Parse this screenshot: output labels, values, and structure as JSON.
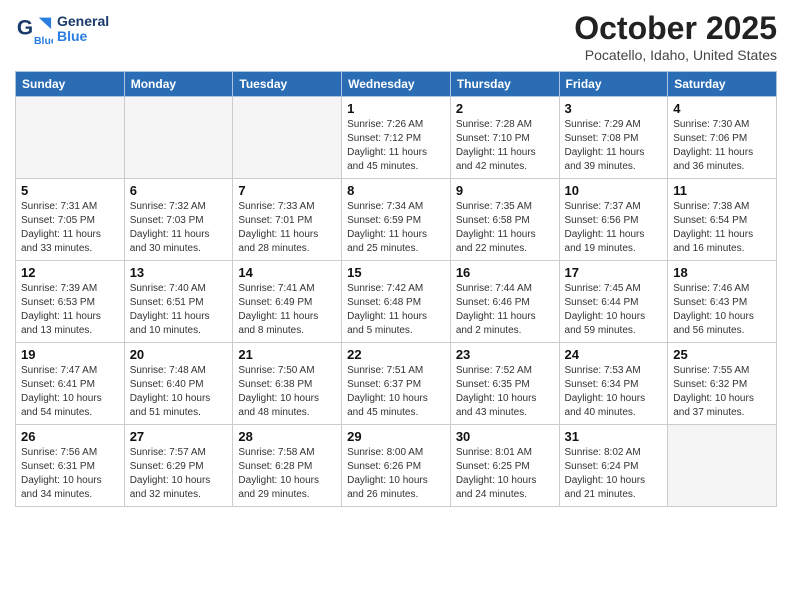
{
  "header": {
    "logo_general": "General",
    "logo_blue": "Blue",
    "month_title": "October 2025",
    "location": "Pocatello, Idaho, United States"
  },
  "days_of_week": [
    "Sunday",
    "Monday",
    "Tuesday",
    "Wednesday",
    "Thursday",
    "Friday",
    "Saturday"
  ],
  "weeks": [
    [
      {
        "day": "",
        "text": ""
      },
      {
        "day": "",
        "text": ""
      },
      {
        "day": "",
        "text": ""
      },
      {
        "day": "1",
        "text": "Sunrise: 7:26 AM\nSunset: 7:12 PM\nDaylight: 11 hours\nand 45 minutes."
      },
      {
        "day": "2",
        "text": "Sunrise: 7:28 AM\nSunset: 7:10 PM\nDaylight: 11 hours\nand 42 minutes."
      },
      {
        "day": "3",
        "text": "Sunrise: 7:29 AM\nSunset: 7:08 PM\nDaylight: 11 hours\nand 39 minutes."
      },
      {
        "day": "4",
        "text": "Sunrise: 7:30 AM\nSunset: 7:06 PM\nDaylight: 11 hours\nand 36 minutes."
      }
    ],
    [
      {
        "day": "5",
        "text": "Sunrise: 7:31 AM\nSunset: 7:05 PM\nDaylight: 11 hours\nand 33 minutes."
      },
      {
        "day": "6",
        "text": "Sunrise: 7:32 AM\nSunset: 7:03 PM\nDaylight: 11 hours\nand 30 minutes."
      },
      {
        "day": "7",
        "text": "Sunrise: 7:33 AM\nSunset: 7:01 PM\nDaylight: 11 hours\nand 28 minutes."
      },
      {
        "day": "8",
        "text": "Sunrise: 7:34 AM\nSunset: 6:59 PM\nDaylight: 11 hours\nand 25 minutes."
      },
      {
        "day": "9",
        "text": "Sunrise: 7:35 AM\nSunset: 6:58 PM\nDaylight: 11 hours\nand 22 minutes."
      },
      {
        "day": "10",
        "text": "Sunrise: 7:37 AM\nSunset: 6:56 PM\nDaylight: 11 hours\nand 19 minutes."
      },
      {
        "day": "11",
        "text": "Sunrise: 7:38 AM\nSunset: 6:54 PM\nDaylight: 11 hours\nand 16 minutes."
      }
    ],
    [
      {
        "day": "12",
        "text": "Sunrise: 7:39 AM\nSunset: 6:53 PM\nDaylight: 11 hours\nand 13 minutes."
      },
      {
        "day": "13",
        "text": "Sunrise: 7:40 AM\nSunset: 6:51 PM\nDaylight: 11 hours\nand 10 minutes."
      },
      {
        "day": "14",
        "text": "Sunrise: 7:41 AM\nSunset: 6:49 PM\nDaylight: 11 hours\nand 8 minutes."
      },
      {
        "day": "15",
        "text": "Sunrise: 7:42 AM\nSunset: 6:48 PM\nDaylight: 11 hours\nand 5 minutes."
      },
      {
        "day": "16",
        "text": "Sunrise: 7:44 AM\nSunset: 6:46 PM\nDaylight: 11 hours\nand 2 minutes."
      },
      {
        "day": "17",
        "text": "Sunrise: 7:45 AM\nSunset: 6:44 PM\nDaylight: 10 hours\nand 59 minutes."
      },
      {
        "day": "18",
        "text": "Sunrise: 7:46 AM\nSunset: 6:43 PM\nDaylight: 10 hours\nand 56 minutes."
      }
    ],
    [
      {
        "day": "19",
        "text": "Sunrise: 7:47 AM\nSunset: 6:41 PM\nDaylight: 10 hours\nand 54 minutes."
      },
      {
        "day": "20",
        "text": "Sunrise: 7:48 AM\nSunset: 6:40 PM\nDaylight: 10 hours\nand 51 minutes."
      },
      {
        "day": "21",
        "text": "Sunrise: 7:50 AM\nSunset: 6:38 PM\nDaylight: 10 hours\nand 48 minutes."
      },
      {
        "day": "22",
        "text": "Sunrise: 7:51 AM\nSunset: 6:37 PM\nDaylight: 10 hours\nand 45 minutes."
      },
      {
        "day": "23",
        "text": "Sunrise: 7:52 AM\nSunset: 6:35 PM\nDaylight: 10 hours\nand 43 minutes."
      },
      {
        "day": "24",
        "text": "Sunrise: 7:53 AM\nSunset: 6:34 PM\nDaylight: 10 hours\nand 40 minutes."
      },
      {
        "day": "25",
        "text": "Sunrise: 7:55 AM\nSunset: 6:32 PM\nDaylight: 10 hours\nand 37 minutes."
      }
    ],
    [
      {
        "day": "26",
        "text": "Sunrise: 7:56 AM\nSunset: 6:31 PM\nDaylight: 10 hours\nand 34 minutes."
      },
      {
        "day": "27",
        "text": "Sunrise: 7:57 AM\nSunset: 6:29 PM\nDaylight: 10 hours\nand 32 minutes."
      },
      {
        "day": "28",
        "text": "Sunrise: 7:58 AM\nSunset: 6:28 PM\nDaylight: 10 hours\nand 29 minutes."
      },
      {
        "day": "29",
        "text": "Sunrise: 8:00 AM\nSunset: 6:26 PM\nDaylight: 10 hours\nand 26 minutes."
      },
      {
        "day": "30",
        "text": "Sunrise: 8:01 AM\nSunset: 6:25 PM\nDaylight: 10 hours\nand 24 minutes."
      },
      {
        "day": "31",
        "text": "Sunrise: 8:02 AM\nSunset: 6:24 PM\nDaylight: 10 hours\nand 21 minutes."
      },
      {
        "day": "",
        "text": ""
      }
    ]
  ]
}
